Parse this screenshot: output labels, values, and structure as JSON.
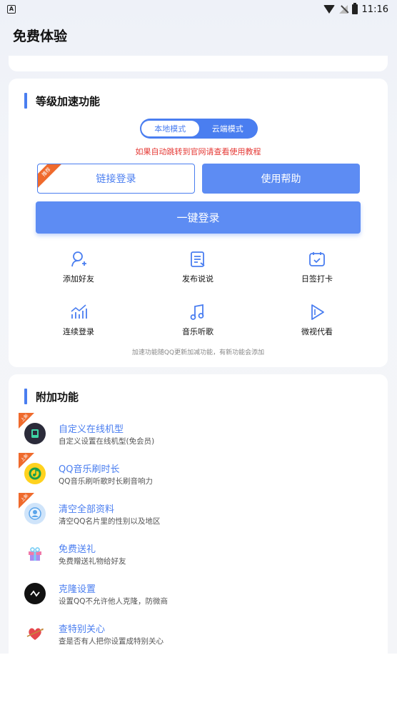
{
  "status_bar": {
    "time": "11:16"
  },
  "page": {
    "title": "免费体验"
  },
  "speed_section": {
    "title": "等级加速功能",
    "modes": [
      "本地模式",
      "云端模式"
    ],
    "active_mode": "本地模式",
    "notice": "如果自动跳转到官网请查看使用教程",
    "link_login_label": "链接登录",
    "link_login_tag": "推荐",
    "help_label": "使用帮助",
    "one_click_label": "一键登录",
    "features": [
      {
        "label": "添加好友",
        "icon": "add-friend-icon"
      },
      {
        "label": "发布说说",
        "icon": "post-icon"
      },
      {
        "label": "日签打卡",
        "icon": "checkin-icon"
      },
      {
        "label": "连续登录",
        "icon": "chart-icon"
      },
      {
        "label": "音乐听歌",
        "icon": "music-icon"
      },
      {
        "label": "微视代看",
        "icon": "play-icon"
      }
    ],
    "footnote": "加速功能随QQ更新加减功能，有新功能会添加"
  },
  "extra_section": {
    "title": "附加功能",
    "items": [
      {
        "title": "自定义在线机型",
        "desc": "自定义设置在线机型(免会员)",
        "tag": "上新",
        "icon": "phone-icon"
      },
      {
        "title": "QQ音乐刷时长",
        "desc": "QQ音乐刷听歌时长刷音响力",
        "tag": "上新",
        "icon": "qqmusic-icon"
      },
      {
        "title": "清空全部资料",
        "desc": "清空QQ名片里的性别以及地区",
        "tag": "上新",
        "icon": "profile-icon"
      },
      {
        "title": "免费送礼",
        "desc": "免费赠送礼物给好友",
        "tag": "",
        "icon": "gift-icon"
      },
      {
        "title": "克隆设置",
        "desc": "设置QQ不允许他人克隆，防微商",
        "tag": "",
        "icon": "clone-icon"
      },
      {
        "title": "查特别关心",
        "desc": "查是否有人把你设置成特别关心",
        "tag": "",
        "icon": "heart-icon"
      }
    ]
  }
}
